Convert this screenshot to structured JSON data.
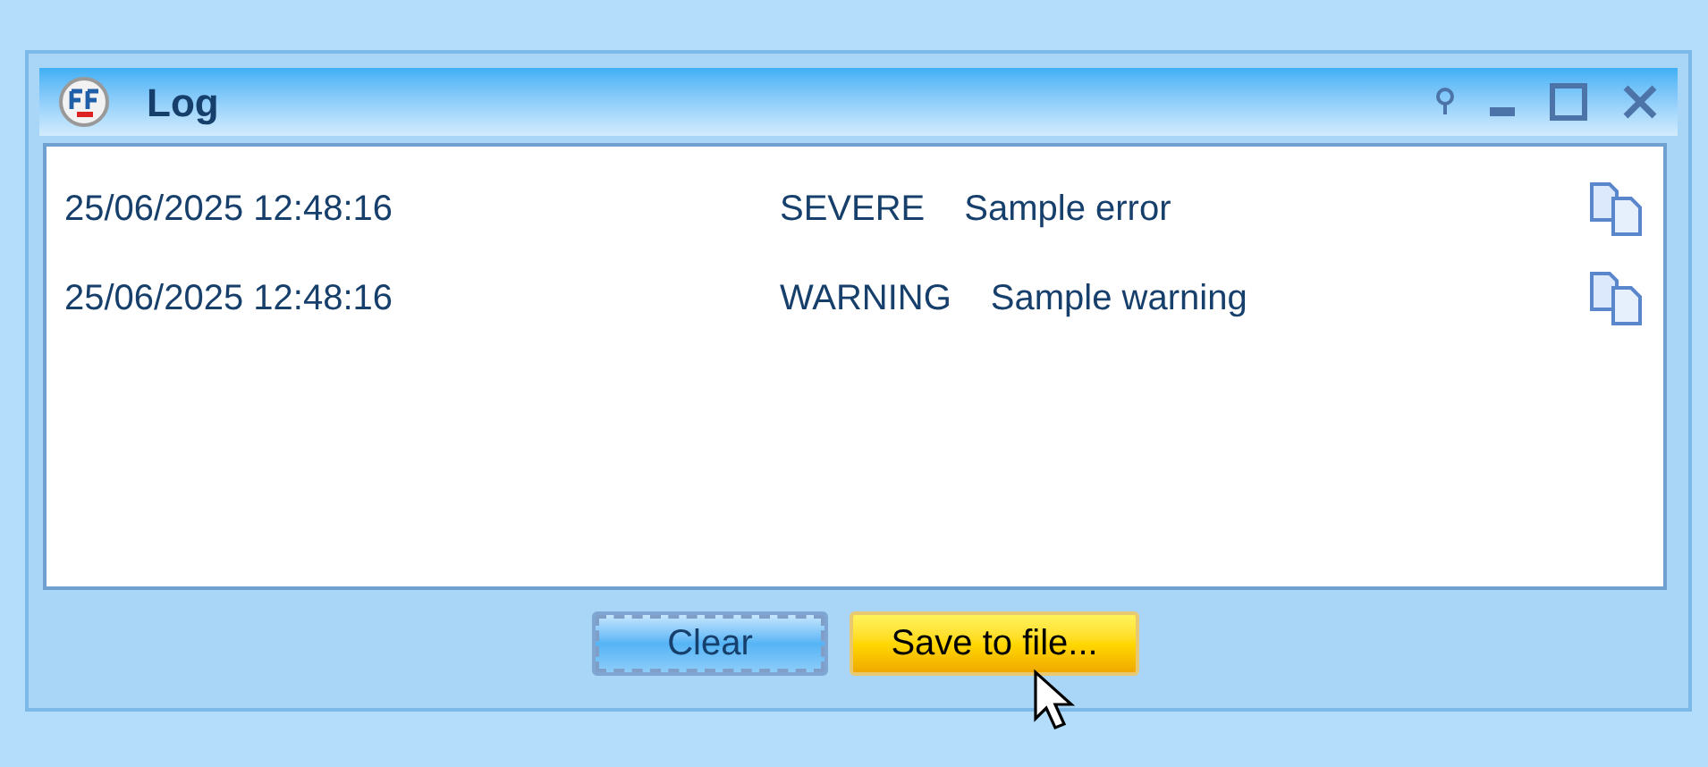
{
  "window": {
    "title": "Log"
  },
  "entries": [
    {
      "time": "25/06/2025 12:48:16",
      "level": "SEVERE",
      "message": "Sample error"
    },
    {
      "time": "25/06/2025 12:48:16",
      "level": "WARNING",
      "message": "Sample warning"
    }
  ],
  "buttons": [
    {
      "label": "Clear",
      "focused": true,
      "hovered": false
    },
    {
      "label": "Save to file...",
      "focused": false,
      "hovered": true
    }
  ]
}
